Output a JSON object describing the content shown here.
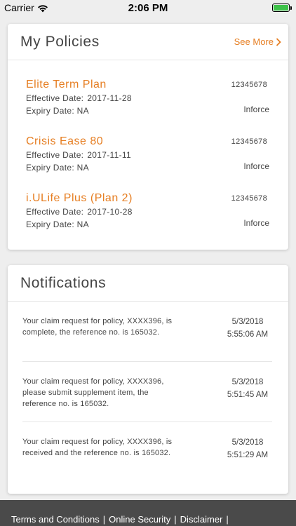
{
  "status_bar": {
    "carrier": "Carrier",
    "time": "2:06 PM",
    "battery_level": 1.0,
    "battery_color": "#3ec24a"
  },
  "policies": {
    "title": "My Policies",
    "see_more": "See More",
    "effective_label": "Effective Date:",
    "expiry_label": "Expiry Date:",
    "items": [
      {
        "name": "Elite Term Plan",
        "effective": "2017-11-28",
        "expiry": "NA",
        "number": "12345678",
        "status": "Inforce"
      },
      {
        "name": "Crisis Ease 80",
        "effective": "2017-11-11",
        "expiry": "NA",
        "number": "12345678",
        "status": "Inforce"
      },
      {
        "name": "i.ULife Plus (Plan 2)",
        "effective": "2017-10-28",
        "expiry": "NA",
        "number": "12345678",
        "status": "Inforce"
      }
    ]
  },
  "notifications": {
    "title": "Notifications",
    "items": [
      {
        "text": "Your claim request for policy, XXXX396, is complete, the reference no. is 165032.",
        "date": "5/3/2018",
        "time": "5:55:06 AM"
      },
      {
        "text": "Your claim request for policy, XXXX396, please submit supplement item, the reference no. is 165032.",
        "date": "5/3/2018",
        "time": "5:51:45 AM"
      },
      {
        "text": "Your claim request for policy, XXXX396, is received and the reference no. is 165032.",
        "date": "5/3/2018",
        "time": "5:51:29 AM"
      }
    ]
  },
  "footer": {
    "links": [
      "Terms and Conditions",
      "Online Security",
      "Disclaimer"
    ],
    "separator": "|"
  },
  "colors": {
    "accent": "#e67e22",
    "footer_bg": "#4a4a4a",
    "page_bg": "#eeeeee"
  }
}
